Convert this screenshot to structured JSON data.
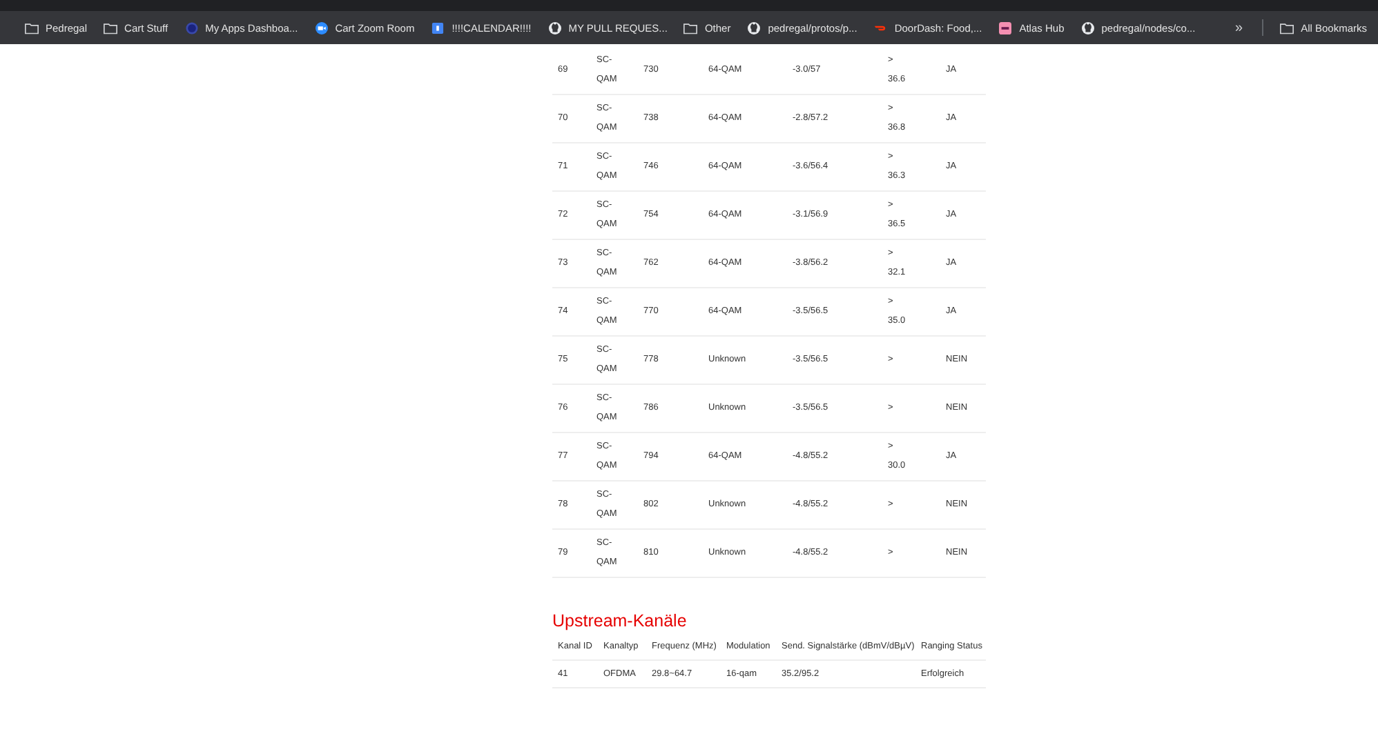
{
  "bookmarks": [
    {
      "kind": "folder",
      "label": "Pedregal"
    },
    {
      "kind": "folder",
      "label": "Cart Stuff"
    },
    {
      "kind": "circle",
      "label": "My Apps Dashboa..."
    },
    {
      "kind": "zoom",
      "label": "Cart Zoom Room"
    },
    {
      "kind": "calendar",
      "label": "!!!!CALENDAR!!!!"
    },
    {
      "kind": "github",
      "label": "MY PULL REQUES..."
    },
    {
      "kind": "folder",
      "label": "Other"
    },
    {
      "kind": "github",
      "label": "pedregal/protos/p..."
    },
    {
      "kind": "doordash",
      "label": "DoorDash: Food,..."
    },
    {
      "kind": "atlas",
      "label": "Atlas Hub"
    },
    {
      "kind": "github",
      "label": "pedregal/nodes/co..."
    }
  ],
  "overflow": "»",
  "all_bookmarks": "All Bookmarks",
  "downstream": {
    "rows": [
      [
        "69",
        "SC-QAM",
        "730",
        "64-QAM",
        "-3.0/57",
        "> 36.6",
        "JA"
      ],
      [
        "70",
        "SC-QAM",
        "738",
        "64-QAM",
        "-2.8/57.2",
        "> 36.8",
        "JA"
      ],
      [
        "71",
        "SC-QAM",
        "746",
        "64-QAM",
        "-3.6/56.4",
        "> 36.3",
        "JA"
      ],
      [
        "72",
        "SC-QAM",
        "754",
        "64-QAM",
        "-3.1/56.9",
        "> 36.5",
        "JA"
      ],
      [
        "73",
        "SC-QAM",
        "762",
        "64-QAM",
        "-3.8/56.2",
        "> 32.1",
        "JA"
      ],
      [
        "74",
        "SC-QAM",
        "770",
        "64-QAM",
        "-3.5/56.5",
        "> 35.0",
        "JA"
      ],
      [
        "75",
        "SC-QAM",
        "778",
        "Unknown",
        "-3.5/56.5",
        ">",
        "NEIN"
      ],
      [
        "76",
        "SC-QAM",
        "786",
        "Unknown",
        "-3.5/56.5",
        ">",
        "NEIN"
      ],
      [
        "77",
        "SC-QAM",
        "794",
        "64-QAM",
        "-4.8/55.2",
        "> 30.0",
        "JA"
      ],
      [
        "78",
        "SC-QAM",
        "802",
        "Unknown",
        "-4.8/55.2",
        ">",
        "NEIN"
      ],
      [
        "79",
        "SC-QAM",
        "810",
        "Unknown",
        "-4.8/55.2",
        ">",
        "NEIN"
      ]
    ]
  },
  "upstream": {
    "title": "Upstream-Kanäle",
    "columns": [
      "Kanal ID",
      "Kanaltyp",
      "Frequenz (MHz)",
      "Modulation",
      "Send. Signalstärke (dBmV/dBµV)",
      "Ranging Status"
    ],
    "rows": [
      [
        "41",
        "OFDMA",
        "29.8~64.7",
        "16-qam",
        "35.2/95.2",
        "Erfolgreich"
      ]
    ]
  }
}
